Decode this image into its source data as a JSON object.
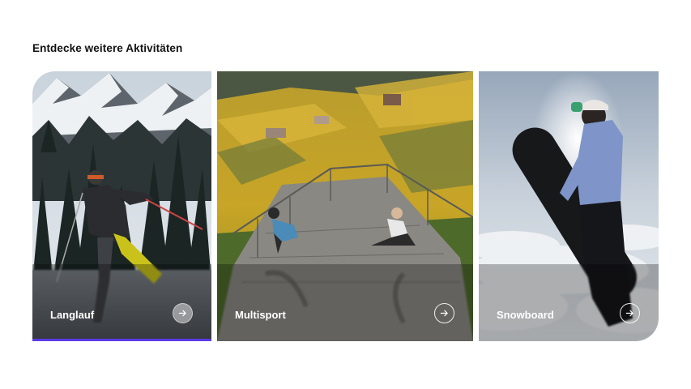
{
  "section": {
    "title": "Entdecke weitere Aktivitäten"
  },
  "cards": [
    {
      "label": "Langlauf",
      "icon": "arrow-right-icon",
      "active": true
    },
    {
      "label": "Multisport",
      "icon": "arrow-right-icon",
      "active": false
    },
    {
      "label": "Snowboard",
      "icon": "arrow-right-icon",
      "active": false
    }
  ],
  "colors": {
    "active_indicator": "#5b3be8",
    "text": "#111111"
  }
}
